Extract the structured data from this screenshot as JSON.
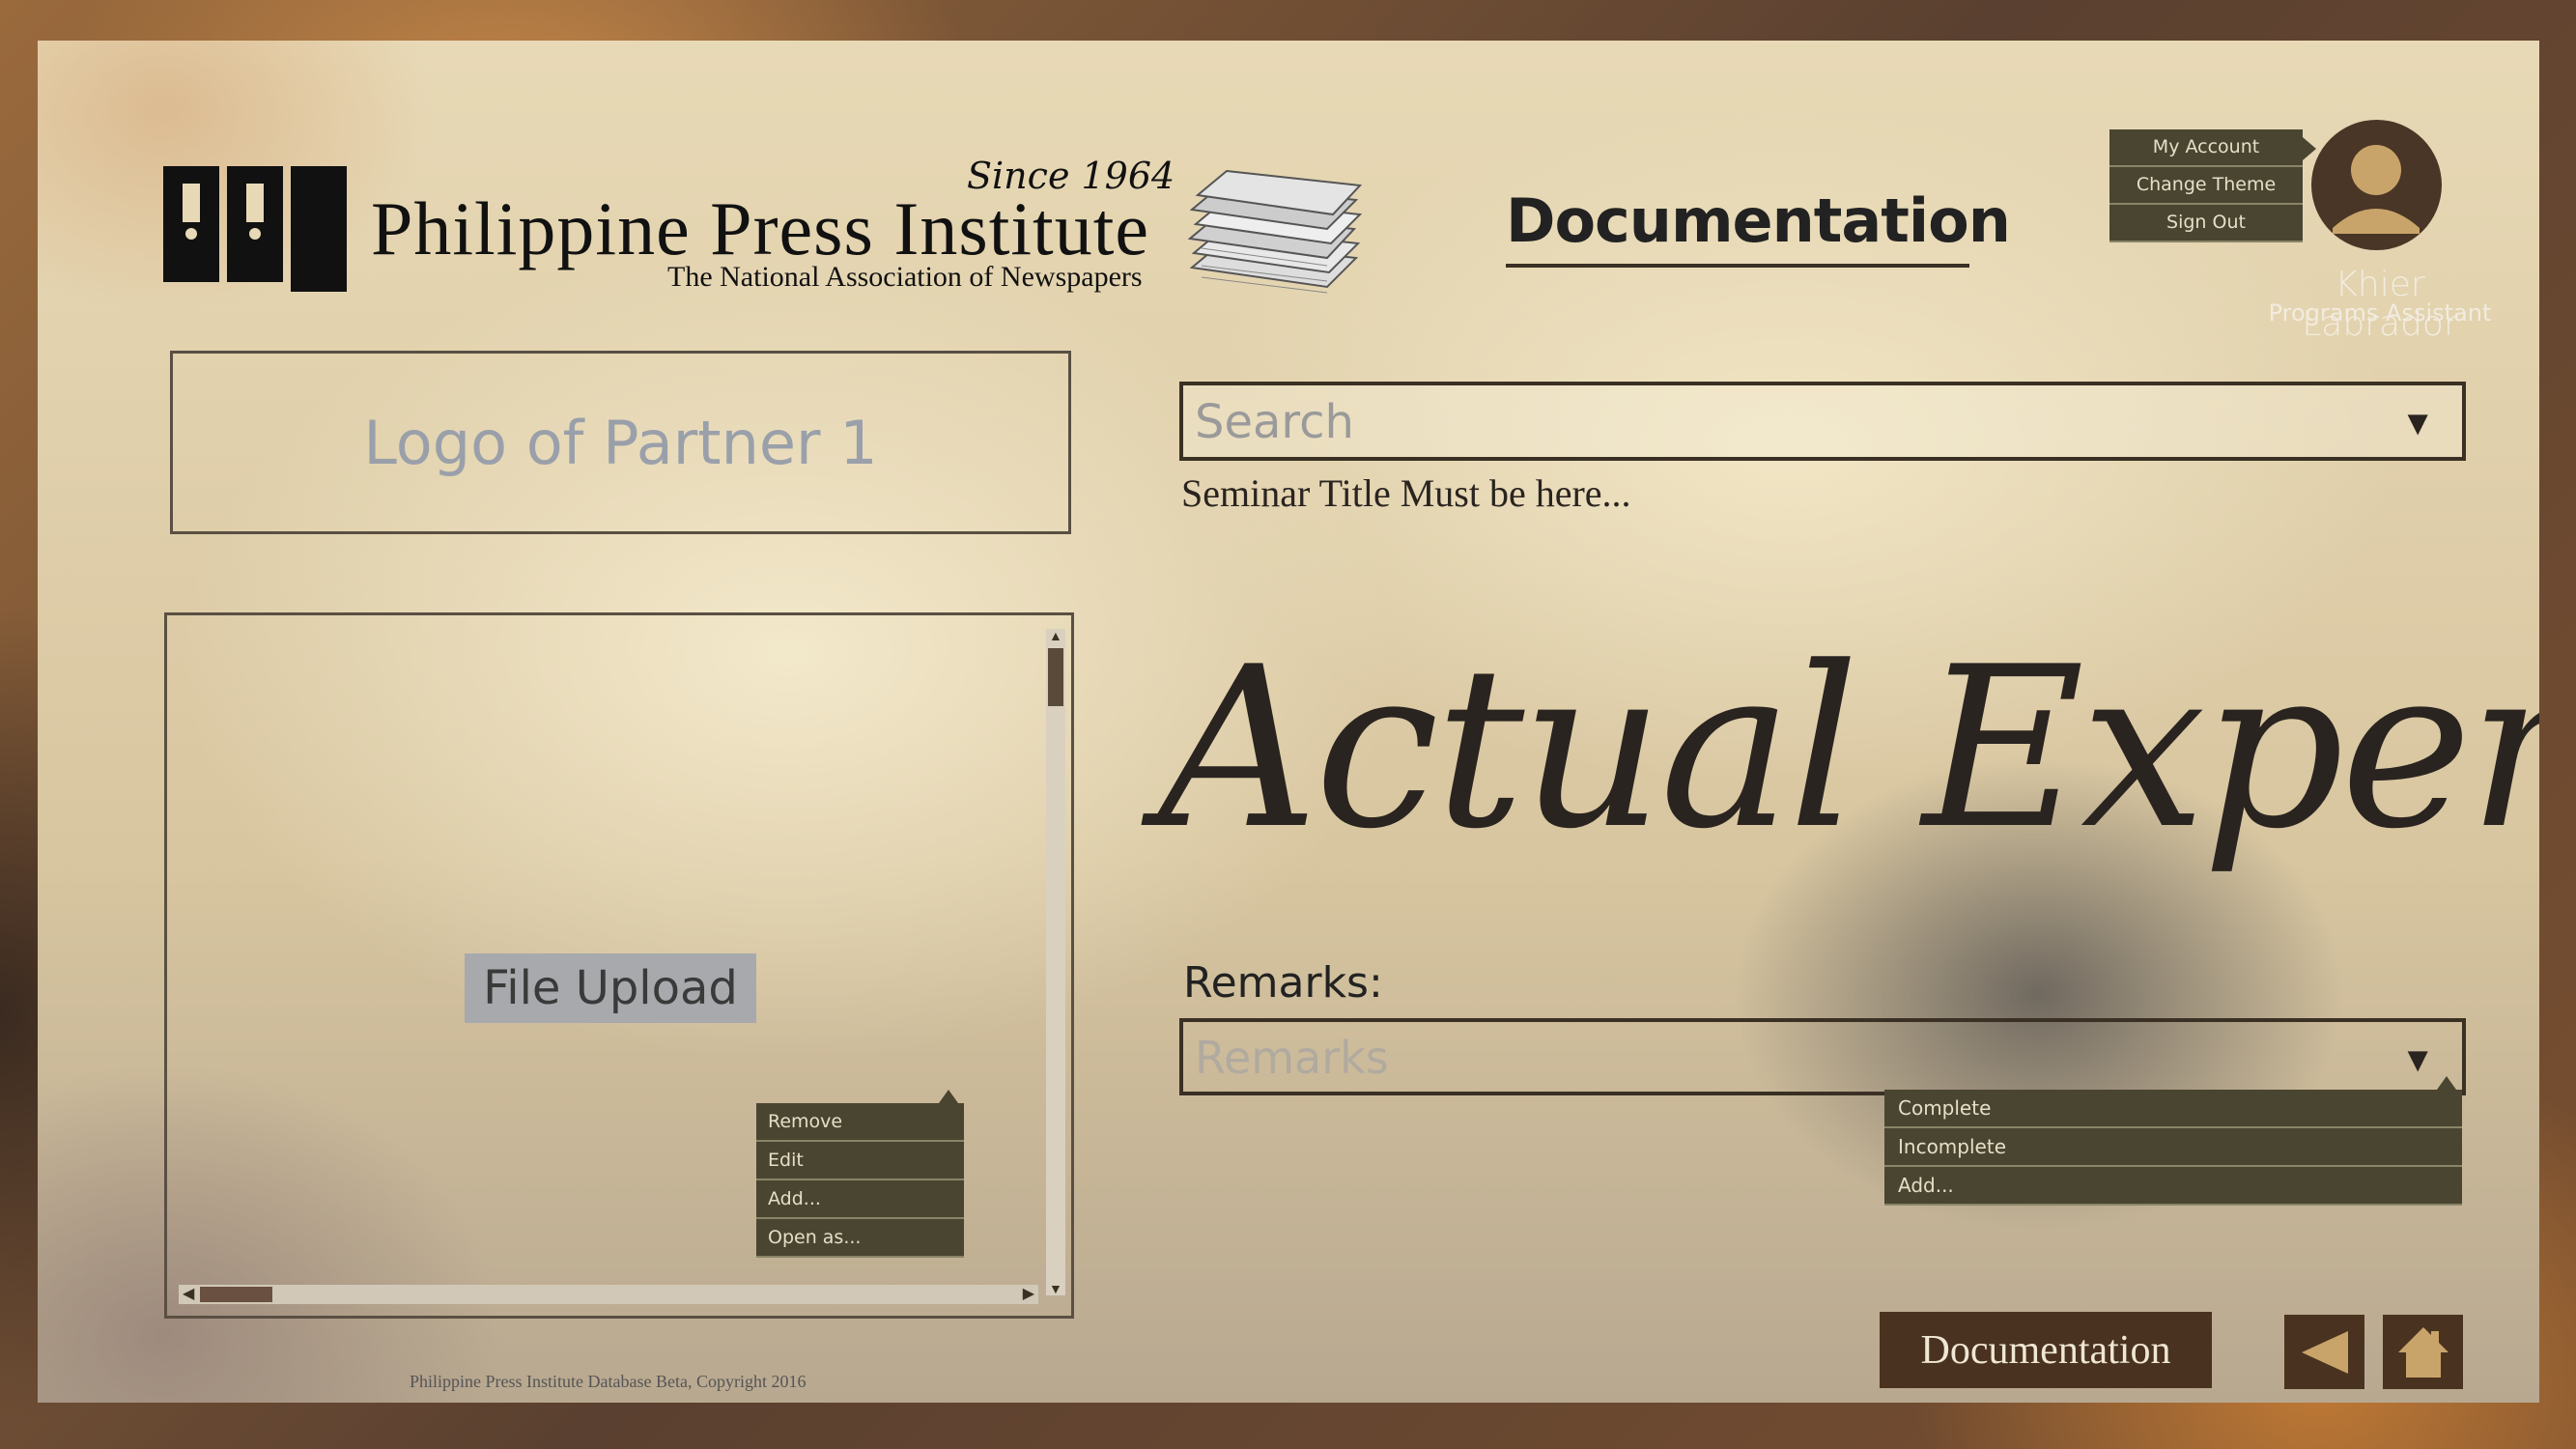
{
  "brand": {
    "logo_text": "PPI",
    "since": "Since 1964",
    "name": "Philippine Press Institute",
    "tagline": "The National Association of Newspapers"
  },
  "header": {
    "section_title": "Documentation"
  },
  "account_menu": {
    "items": [
      "My Account",
      "Change Theme",
      "Sign Out"
    ]
  },
  "user": {
    "name": "Khier Labrador",
    "role": "Programs Assistant"
  },
  "partner_logo": {
    "placeholder": "Logo of Partner 1"
  },
  "file_panel": {
    "upload_label": "File Upload",
    "context_menu": [
      "Remove",
      "Edit",
      "Add...",
      "Open as..."
    ]
  },
  "search": {
    "placeholder": "Search",
    "seminar_hint": "Seminar Title Must be here..."
  },
  "main": {
    "heading": "Actual Expense"
  },
  "remarks": {
    "label": "Remarks:",
    "placeholder": "Remarks",
    "options": [
      "Complete",
      "Incomplete",
      "Add..."
    ]
  },
  "footer": {
    "copyright": "Philippine Press Institute Database Beta, Copyright 2016",
    "documentation_button": "Documentation"
  },
  "icons": {
    "avatar": "user-avatar-icon",
    "back": "back-arrow-icon",
    "home": "home-icon",
    "dropdown": "dropdown-arrow-icon"
  },
  "colors": {
    "accent_dark": "#4a3220",
    "menu_bg": "#4a4530",
    "menu_text": "#e6dfc8",
    "icon_gold": "#c9a46a"
  }
}
